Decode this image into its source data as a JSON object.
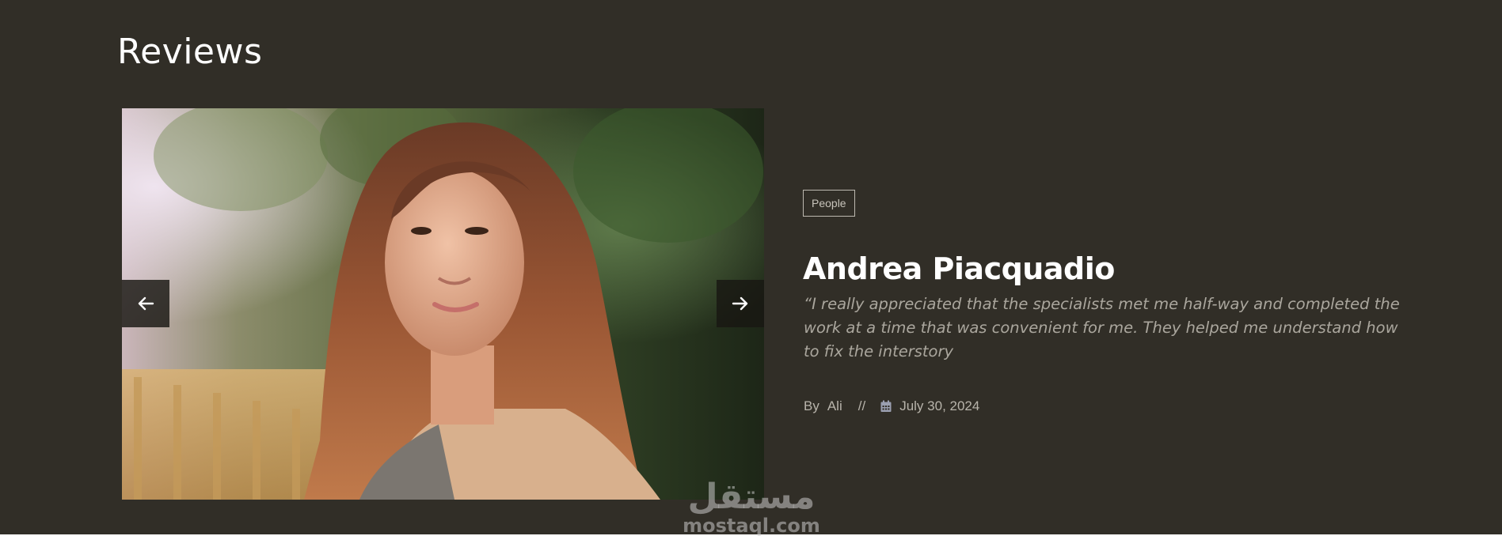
{
  "section": {
    "title": "Reviews",
    "background_color": "#312e27"
  },
  "slider": {
    "photo_icon": "portrait-photo",
    "prev_icon": "arrow-left-icon",
    "next_icon": "arrow-right-icon"
  },
  "review": {
    "category": "People",
    "name": "Andrea Piacquadio",
    "quote": "“I really appreciated that the specialists met me half-way and completed the work at a time that was convenient for me. They helped me understand how to fix the interstory",
    "by_label": "By",
    "author": "Ali",
    "separator": "//",
    "date_icon": "calendar-icon",
    "date": "July 30, 2024"
  },
  "watermark": {
    "arabic": "مستقل",
    "latin": "mostaql.com"
  }
}
